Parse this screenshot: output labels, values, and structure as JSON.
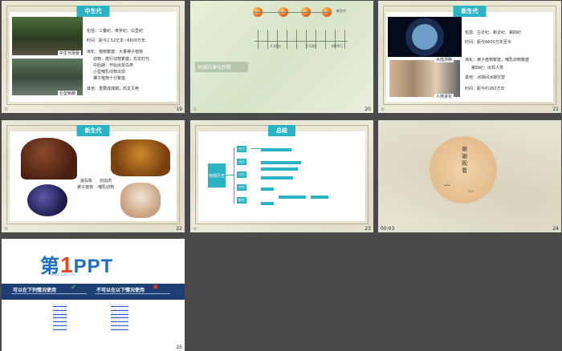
{
  "slides": [
    {
      "number": "19",
      "title": "中生代",
      "cap1": "中生代场景",
      "cap2": "巨型蜥脚",
      "lines": [
        "包括：三叠纪、侏罗纪、白垩纪",
        "时间：距今2.52亿年~6600万年",
        "演化：植物繁盛：大量裸子植物",
        "动物：爬行动物繁盛；恐龙时代",
        "中后期：开始出现鸟类",
        "小型哺乳动物出现",
        "裸子植物十分繁盛",
        "其他：重要成煤期；恐龙灭绝"
      ]
    },
    {
      "number": "20",
      "subtitle": "地球的演化历程",
      "marks": [
        "5.41亿",
        "2.52亿",
        "6600万"
      ],
      "top_label": "新生代"
    },
    {
      "number": "21",
      "title": "新生代",
      "cap1": "大陆漂移",
      "cap2": "人类进化",
      "lines": [
        "包括：古近纪、新近纪、第四纪",
        "时间：距今6600万年至今",
        "演化：被子植物繁盛，哺乳动物繁盛",
        "第四纪：出现人类",
        "其他：冰期间冰期交替",
        "时间：距今约260万年"
      ]
    },
    {
      "number": "22",
      "title": "新生代",
      "lbl_mammoth": "猛犸象",
      "lbl_tiger": "剑齿虎",
      "lbl_plant": "被子植物",
      "lbl_mammal": "哺乳动物"
    },
    {
      "number": "23",
      "title": "总结",
      "root": "地球历史",
      "nodes": [
        "太古",
        "元古",
        "古生",
        "中生",
        "新生"
      ]
    },
    {
      "number": "24",
      "time": "00:03",
      "thanks": "谢谢观看"
    },
    {
      "number": "25",
      "logo_main": "第",
      "logo_one": "1",
      "logo_ppt": "PPT",
      "logo_url": "www.1ppt.com",
      "can_use": "可以在下列情况使用",
      "cannot_use": "不可以在以下情况使用"
    }
  ]
}
